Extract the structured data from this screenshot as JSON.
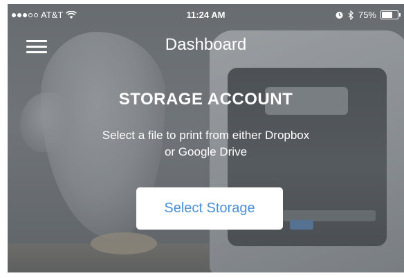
{
  "status_bar": {
    "carrier": "AT&T",
    "signal_bars_filled": 3,
    "signal_bars_total": 5,
    "wifi_icon": "wifi-icon",
    "time": "11:24 AM",
    "alarm_icon": "alarm-icon",
    "bluetooth_icon": "bluetooth-icon",
    "battery_percent": "75%",
    "battery_level": 0.75
  },
  "nav": {
    "menu_icon": "hamburger-menu-icon",
    "title": "Dashboard"
  },
  "main": {
    "title": "STORAGE ACCOUNT",
    "description_line1": "Select a file to print from either Dropbox",
    "description_line2": "or Google Drive",
    "select_button_label": "Select Storage"
  },
  "colors": {
    "accent": "#4a8fd6",
    "text": "#ffffff",
    "button_bg": "#ffffff"
  }
}
